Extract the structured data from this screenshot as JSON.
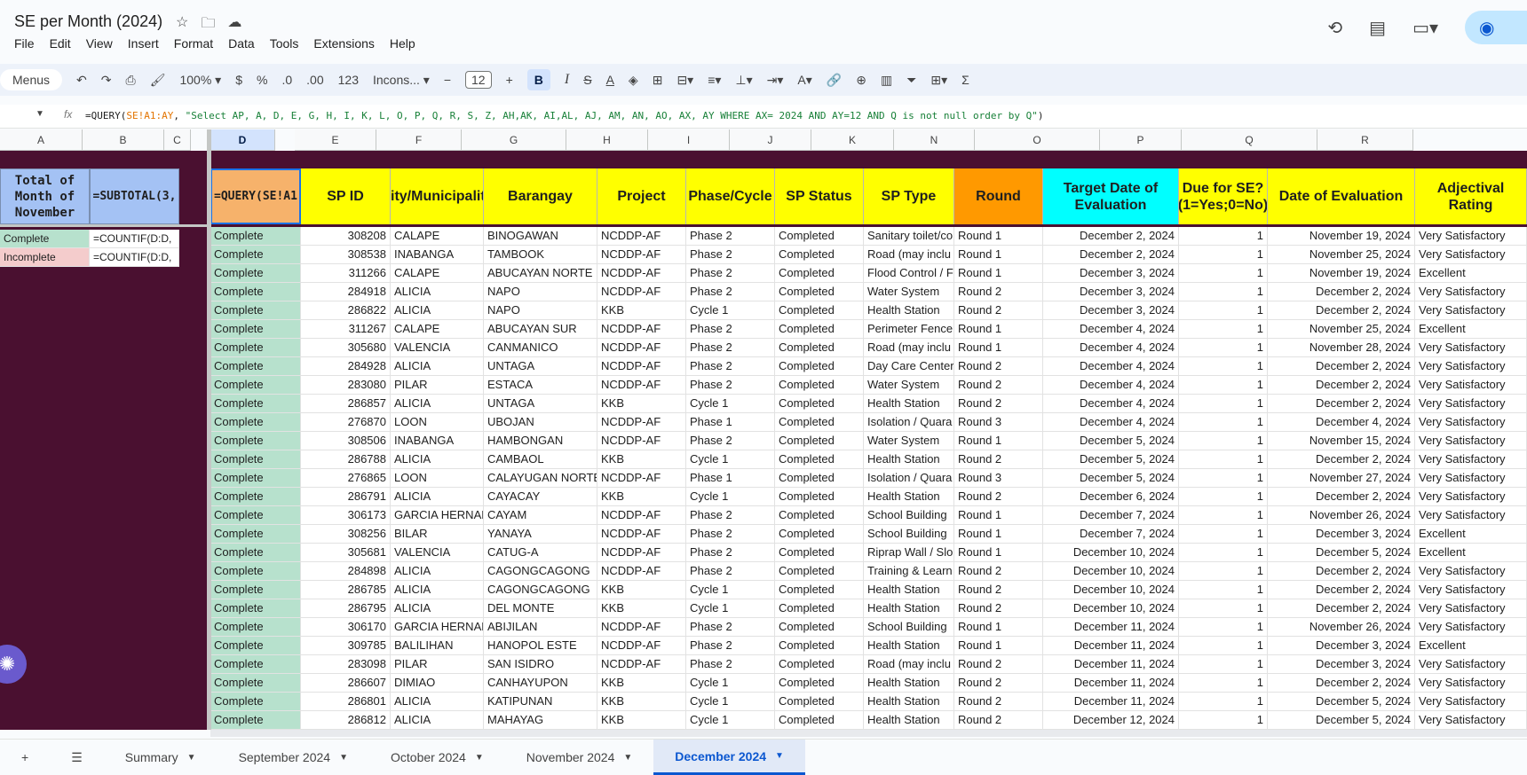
{
  "title": "SE per Month (2024)",
  "menu": [
    "File",
    "Edit",
    "View",
    "Insert",
    "Format",
    "Data",
    "Tools",
    "Extensions",
    "Help"
  ],
  "toolbar": {
    "menus": "Menus",
    "zoom": "100%",
    "currency": "$",
    "percent": "%",
    "dec_minus": ".0",
    "dec_plus": ".00",
    "number_format": "123",
    "font": "Incons...",
    "font_size": "12",
    "bold": "B",
    "italic": "I"
  },
  "formula_bar": {
    "prefix": "=QUERY(",
    "ref": "SE!A1:AY",
    "sep": ", ",
    "query": "\"Select AP, A, D, E, G, H, I, K, L, O, P, Q, R, S, Z, AH,AK, AI,AL, AJ, AM, AN, AO, AX, AY WHERE AX= 2024 AND AY=12 AND Q is not null order by Q\"",
    "suffix": ")"
  },
  "columns": [
    "A",
    "B",
    "C",
    "D",
    "E",
    "F",
    "G",
    "H",
    "I",
    "J",
    "K",
    "N",
    "O",
    "P",
    "Q",
    "R"
  ],
  "left_panel": {
    "header_label": "Total of Month of November",
    "header_formula": "=SUBTOTAL(3,",
    "rows": [
      {
        "label": "Complete",
        "formula": "=COUNTIF(D:D,"
      },
      {
        "label": "Incomplete",
        "formula": "=COUNTIF(D:D,"
      }
    ]
  },
  "headers": [
    "=QUERY(SE!A1",
    "SP ID",
    "City/Municipality",
    "Barangay",
    "Project",
    "Phase/Cycle",
    "SP Status",
    "SP Type",
    "Round",
    "Target Date of Evaluation",
    "Due for SE? (1=Yes;0=No)",
    "Date of Evaluation",
    "Adjectival Rating"
  ],
  "header_colors": [
    "#f6b26b",
    "#ffff00",
    "#ffff00",
    "#ffff00",
    "#ffff00",
    "#ffff00",
    "#ffff00",
    "#ffff00",
    "#ff9900",
    "#00ffff",
    "#ffff00",
    "#ffff00",
    "#ffff00"
  ],
  "rows": [
    [
      "Complete",
      "308208",
      "CALAPE",
      "BINOGAWAN",
      "NCDDP-AF",
      "Phase 2",
      "Completed",
      "Sanitary toilet/co",
      "Round 1",
      "December 2, 2024",
      "1",
      "November 19, 2024",
      "Very Satisfactory"
    ],
    [
      "Complete",
      "308538",
      "INABANGA",
      "TAMBOOK",
      "NCDDP-AF",
      "Phase 2",
      "Completed",
      "Road (may inclu",
      "Round 1",
      "December 2, 2024",
      "1",
      "November 25, 2024",
      "Very Satisfactory"
    ],
    [
      "Complete",
      "311266",
      "CALAPE",
      "ABUCAYAN NORTE",
      "NCDDP-AF",
      "Phase 2",
      "Completed",
      "Flood Control / F",
      "Round 1",
      "December 3, 2024",
      "1",
      "November 19, 2024",
      "Excellent"
    ],
    [
      "Complete",
      "284918",
      "ALICIA",
      "NAPO",
      "NCDDP-AF",
      "Phase 2",
      "Completed",
      "Water System",
      "Round 2",
      "December 3, 2024",
      "1",
      "December 2, 2024",
      "Very Satisfactory"
    ],
    [
      "Complete",
      "286822",
      "ALICIA",
      "NAPO",
      "KKB",
      "Cycle 1",
      "Completed",
      "Health Station",
      "Round 2",
      "December 3, 2024",
      "1",
      "December 2, 2024",
      "Very Satisfactory"
    ],
    [
      "Complete",
      "311267",
      "CALAPE",
      "ABUCAYAN SUR",
      "NCDDP-AF",
      "Phase 2",
      "Completed",
      "Perimeter Fence",
      "Round 1",
      "December 4, 2024",
      "1",
      "November 25, 2024",
      "Excellent"
    ],
    [
      "Complete",
      "305680",
      "VALENCIA",
      "CANMANICO",
      "NCDDP-AF",
      "Phase 2",
      "Completed",
      "Road (may inclu",
      "Round 1",
      "December 4, 2024",
      "1",
      "November 28, 2024",
      "Very Satisfactory"
    ],
    [
      "Complete",
      "284928",
      "ALICIA",
      "UNTAGA",
      "NCDDP-AF",
      "Phase 2",
      "Completed",
      "Day Care Center",
      "Round 2",
      "December 4, 2024",
      "1",
      "December 2, 2024",
      "Very Satisfactory"
    ],
    [
      "Complete",
      "283080",
      "PILAR",
      "ESTACA",
      "NCDDP-AF",
      "Phase 2",
      "Completed",
      "Water System",
      "Round 2",
      "December 4, 2024",
      "1",
      "December 2, 2024",
      "Very Satisfactory"
    ],
    [
      "Complete",
      "286857",
      "ALICIA",
      "UNTAGA",
      "KKB",
      "Cycle 1",
      "Completed",
      "Health Station",
      "Round 2",
      "December 4, 2024",
      "1",
      "December 2, 2024",
      "Very Satisfactory"
    ],
    [
      "Complete",
      "276870",
      "LOON",
      "UBOJAN",
      "NCDDP-AF",
      "Phase 1",
      "Completed",
      "Isolation / Quara",
      "Round 3",
      "December 4, 2024",
      "1",
      "December 4, 2024",
      "Very Satisfactory"
    ],
    [
      "Complete",
      "308506",
      "INABANGA",
      "HAMBONGAN",
      "NCDDP-AF",
      "Phase 2",
      "Completed",
      "Water System",
      "Round 1",
      "December 5, 2024",
      "1",
      "November 15, 2024",
      "Very Satisfactory"
    ],
    [
      "Complete",
      "286788",
      "ALICIA",
      "CAMBAOL",
      "KKB",
      "Cycle 1",
      "Completed",
      "Health Station",
      "Round 2",
      "December 5, 2024",
      "1",
      "December 2, 2024",
      "Very Satisfactory"
    ],
    [
      "Complete",
      "276865",
      "LOON",
      "CALAYUGAN NORTE",
      "NCDDP-AF",
      "Phase 1",
      "Completed",
      "Isolation / Quara",
      "Round 3",
      "December 5, 2024",
      "1",
      "November 27, 2024",
      "Very Satisfactory"
    ],
    [
      "Complete",
      "286791",
      "ALICIA",
      "CAYACAY",
      "KKB",
      "Cycle 1",
      "Completed",
      "Health Station",
      "Round 2",
      "December 6, 2024",
      "1",
      "December 2, 2024",
      "Very Satisfactory"
    ],
    [
      "Complete",
      "306173",
      "GARCIA HERNANDEZ",
      "CAYAM",
      "NCDDP-AF",
      "Phase 2",
      "Completed",
      "School Building",
      "Round 1",
      "December 7, 2024",
      "1",
      "November 26, 2024",
      "Very Satisfactory"
    ],
    [
      "Complete",
      "308256",
      "BILAR",
      "YANAYA",
      "NCDDP-AF",
      "Phase 2",
      "Completed",
      "School Building",
      "Round 1",
      "December 7, 2024",
      "1",
      "December 3, 2024",
      "Excellent"
    ],
    [
      "Complete",
      "305681",
      "VALENCIA",
      "CATUG-A",
      "NCDDP-AF",
      "Phase 2",
      "Completed",
      "Riprap Wall / Slo",
      "Round 1",
      "December 10, 2024",
      "1",
      "December 5, 2024",
      "Excellent"
    ],
    [
      "Complete",
      "284898",
      "ALICIA",
      "CAGONGCAGONG",
      "NCDDP-AF",
      "Phase 2",
      "Completed",
      "Training & Learn",
      "Round 2",
      "December 10, 2024",
      "1",
      "December 2, 2024",
      "Very Satisfactory"
    ],
    [
      "Complete",
      "286785",
      "ALICIA",
      "CAGONGCAGONG",
      "KKB",
      "Cycle 1",
      "Completed",
      "Health Station",
      "Round 2",
      "December 10, 2024",
      "1",
      "December 2, 2024",
      "Very Satisfactory"
    ],
    [
      "Complete",
      "286795",
      "ALICIA",
      "DEL MONTE",
      "KKB",
      "Cycle 1",
      "Completed",
      "Health Station",
      "Round 2",
      "December 10, 2024",
      "1",
      "December 2, 2024",
      "Very Satisfactory"
    ],
    [
      "Complete",
      "306170",
      "GARCIA HERNANDEZ",
      "ABIJILAN",
      "NCDDP-AF",
      "Phase 2",
      "Completed",
      "School Building",
      "Round 1",
      "December 11, 2024",
      "1",
      "November 26, 2024",
      "Very Satisfactory"
    ],
    [
      "Complete",
      "309785",
      "BALILIHAN",
      "HANOPOL ESTE",
      "NCDDP-AF",
      "Phase 2",
      "Completed",
      "Health Station",
      "Round 1",
      "December 11, 2024",
      "1",
      "December 3, 2024",
      "Excellent"
    ],
    [
      "Complete",
      "283098",
      "PILAR",
      "SAN ISIDRO",
      "NCDDP-AF",
      "Phase 2",
      "Completed",
      "Road (may inclu",
      "Round 2",
      "December 11, 2024",
      "1",
      "December 3, 2024",
      "Very Satisfactory"
    ],
    [
      "Complete",
      "286607",
      "DIMIAO",
      "CANHAYUPON",
      "KKB",
      "Cycle 1",
      "Completed",
      "Health Station",
      "Round 2",
      "December 11, 2024",
      "1",
      "December 2, 2024",
      "Very Satisfactory"
    ],
    [
      "Complete",
      "286801",
      "ALICIA",
      "KATIPUNAN",
      "KKB",
      "Cycle 1",
      "Completed",
      "Health Station",
      "Round 2",
      "December 11, 2024",
      "1",
      "December 5, 2024",
      "Very Satisfactory"
    ],
    [
      "Complete",
      "286812",
      "ALICIA",
      "MAHAYAG",
      "KKB",
      "Cycle 1",
      "Completed",
      "Health Station",
      "Round 2",
      "December 12, 2024",
      "1",
      "December 5, 2024",
      "Very Satisfactory"
    ]
  ],
  "sheets": [
    {
      "label": "Summary",
      "active": false
    },
    {
      "label": "September 2024",
      "active": false
    },
    {
      "label": "October 2024",
      "active": false
    },
    {
      "label": "November 2024",
      "active": false
    },
    {
      "label": "December 2024",
      "active": true
    }
  ]
}
